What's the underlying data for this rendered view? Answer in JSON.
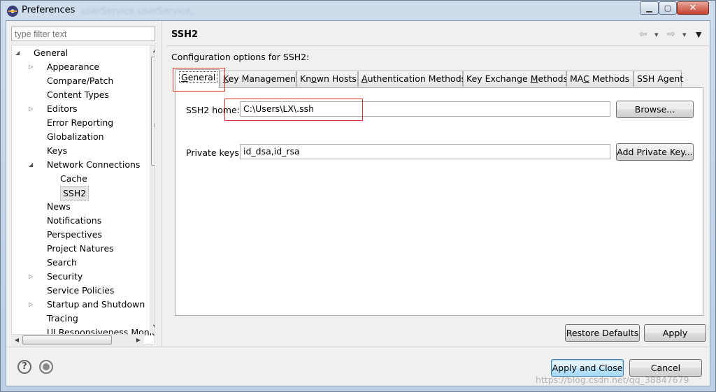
{
  "window": {
    "title": "Preferences",
    "background_title": "userService.userService,",
    "controls": {
      "minimize": "▁",
      "maximize": "▢",
      "close": "✕"
    }
  },
  "filter": {
    "placeholder": "type filter text"
  },
  "tree": {
    "items": [
      {
        "label": "General",
        "level": 0,
        "twisty": "expanded"
      },
      {
        "label": "Appearance",
        "level": 1,
        "twisty": "collapsed"
      },
      {
        "label": "Compare/Patch",
        "level": 1,
        "twisty": "none"
      },
      {
        "label": "Content Types",
        "level": 1,
        "twisty": "none"
      },
      {
        "label": "Editors",
        "level": 1,
        "twisty": "collapsed"
      },
      {
        "label": "Error Reporting",
        "level": 1,
        "twisty": "none"
      },
      {
        "label": "Globalization",
        "level": 1,
        "twisty": "none"
      },
      {
        "label": "Keys",
        "level": 1,
        "twisty": "none"
      },
      {
        "label": "Network Connections",
        "level": 1,
        "twisty": "expanded"
      },
      {
        "label": "Cache",
        "level": 2,
        "twisty": "none"
      },
      {
        "label": "SSH2",
        "level": 2,
        "twisty": "none",
        "selected": true
      },
      {
        "label": "News",
        "level": 1,
        "twisty": "none"
      },
      {
        "label": "Notifications",
        "level": 1,
        "twisty": "none"
      },
      {
        "label": "Perspectives",
        "level": 1,
        "twisty": "none"
      },
      {
        "label": "Project Natures",
        "level": 1,
        "twisty": "none"
      },
      {
        "label": "Search",
        "level": 1,
        "twisty": "none"
      },
      {
        "label": "Security",
        "level": 1,
        "twisty": "collapsed"
      },
      {
        "label": "Service Policies",
        "level": 1,
        "twisty": "none"
      },
      {
        "label": "Startup and Shutdown",
        "level": 1,
        "twisty": "collapsed"
      },
      {
        "label": "Tracing",
        "level": 1,
        "twisty": "none"
      },
      {
        "label": "UI Responsiveness Monit",
        "level": 1,
        "twisty": "none"
      }
    ]
  },
  "page": {
    "title": "SSH2",
    "description": "Configuration options for SSH2:",
    "history": {
      "back": "⇦",
      "forward": "⇨",
      "dropdown": "▾",
      "menu": "▼"
    }
  },
  "tabs": [
    {
      "label": "General",
      "mnemonic_index": 0,
      "active": true
    },
    {
      "label": "Key Management",
      "mnemonic_index": 0
    },
    {
      "label": "Known Hosts",
      "mnemonic_index": 2
    },
    {
      "label": "Authentication Methods",
      "mnemonic_index": 0
    },
    {
      "label": "Key Exchange Methods",
      "mnemonic_index": 13
    },
    {
      "label": "MAC Methods",
      "mnemonic_index": 2
    },
    {
      "label": "SSH Agent",
      "mnemonic_index": -1
    }
  ],
  "general_tab": {
    "ssh2_home_label": "SSH2 home:",
    "ssh2_home_value": "C:\\Users\\LX\\.ssh",
    "browse_button": "Browse...",
    "private_keys_label": "Private keys:",
    "private_keys_value": "id_dsa,id_rsa",
    "add_private_key_button": "Add Private Key..."
  },
  "buttons": {
    "restore_defaults": "Restore Defaults",
    "apply": "Apply",
    "apply_and_close": "Apply and Close",
    "cancel": "Cancel"
  },
  "footer": {
    "help_icon": "?"
  },
  "watermark": "https://blog.csdn.net/qq_38847679",
  "colors": {
    "annotation_red": "#e0322f",
    "selection_gray": "#e5e5e5"
  }
}
